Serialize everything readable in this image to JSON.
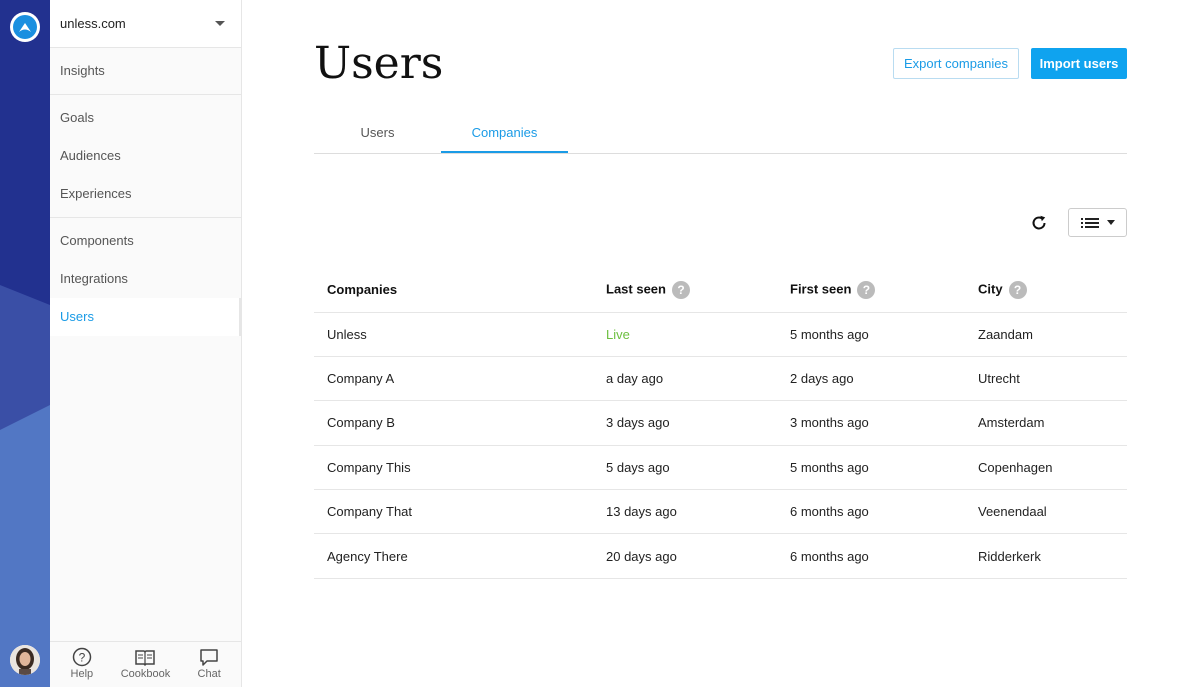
{
  "org": {
    "name": "unless.com"
  },
  "sidebar": {
    "groups": [
      [
        {
          "label": "Insights"
        }
      ],
      [
        {
          "label": "Goals"
        },
        {
          "label": "Audiences"
        },
        {
          "label": "Experiences"
        }
      ],
      [
        {
          "label": "Components"
        },
        {
          "label": "Integrations"
        },
        {
          "label": "Users"
        }
      ]
    ],
    "footer": [
      {
        "label": "Help",
        "icon": "help-icon"
      },
      {
        "label": "Cookbook",
        "icon": "book-icon"
      },
      {
        "label": "Chat",
        "icon": "chat-icon"
      }
    ]
  },
  "page": {
    "title": "Users",
    "export_label": "Export companies",
    "import_label": "Import users",
    "tabs": [
      {
        "label": "Users"
      },
      {
        "label": "Companies"
      }
    ]
  },
  "table": {
    "headers": [
      "Companies",
      "Last seen",
      "First seen",
      "City"
    ],
    "rows": [
      [
        "Unless",
        "Live",
        "5 months ago",
        "Zaandam"
      ],
      [
        "Company A",
        "a day ago",
        "2 days ago",
        "Utrecht"
      ],
      [
        "Company B",
        "3 days ago",
        "3 months ago",
        "Amsterdam"
      ],
      [
        "Company This",
        "5 days ago",
        "5 months ago",
        "Copenhagen"
      ],
      [
        "Company That",
        "13 days ago",
        "6 months ago",
        "Veenendaal"
      ],
      [
        "Agency There",
        "20 days ago",
        "6 months ago",
        "Ridderkerk"
      ]
    ]
  },
  "colors": {
    "accent": "#1a9be6",
    "primary_button": "#0fa3ef",
    "live": "#6cbf3f",
    "rail": "#22318f"
  }
}
